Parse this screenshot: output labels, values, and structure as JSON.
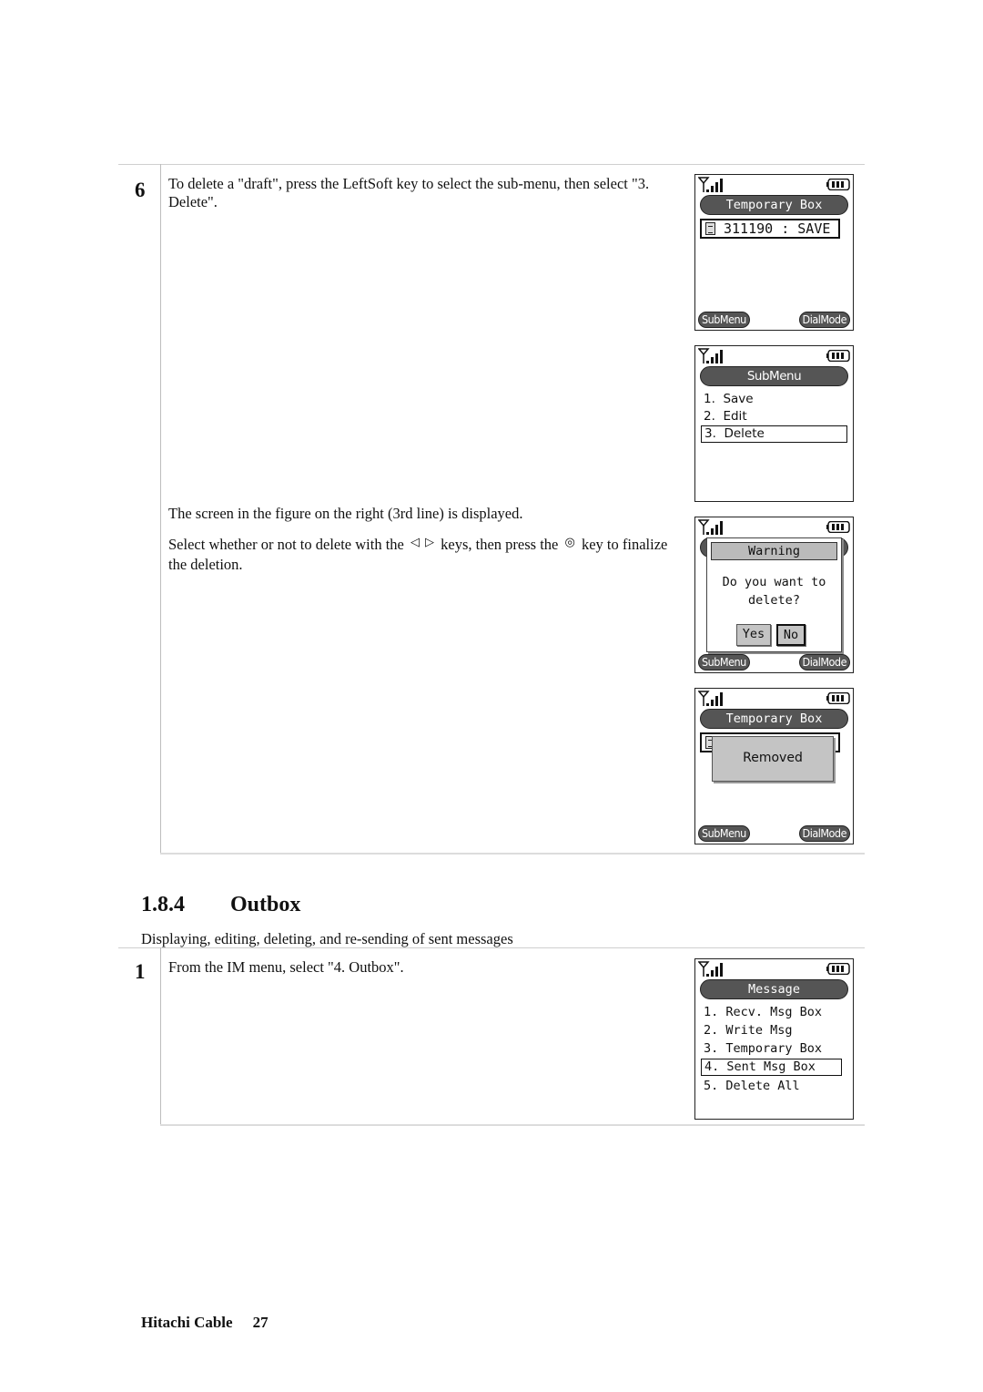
{
  "step6": {
    "number": "6",
    "text": "To delete a \"draft\", press the LeftSoft key to select the sub-menu, then select \"3. Delete\".",
    "displayed_text": "The screen in the figure on the right (3rd line) is displayed.",
    "select_prefix": "Select whether or not to delete with the",
    "left_key_glyph": "◁",
    "right_key_glyph": "▷",
    "select_middle": "keys, then press the",
    "center_key_glyph": "◎",
    "select_suffix": "key to finalize the deletion."
  },
  "screens": {
    "temporary_box": {
      "title": "Temporary Box",
      "entry": "311190 : SAVE",
      "left_softkey": "SubMenu",
      "right_softkey": "DialMode"
    },
    "submenu": {
      "title": "SubMenu",
      "items": [
        {
          "label": "1.  Save",
          "selected": false
        },
        {
          "label": "2.  Edit",
          "selected": false
        },
        {
          "label": "3.  Delete",
          "selected": true
        }
      ]
    },
    "warning": {
      "title": "Warning",
      "message_line1": "Do you want to",
      "message_line2": "delete?",
      "yes_label": "Yes",
      "no_label": "No",
      "left_softkey": "SubMenu",
      "right_softkey": "DialMode"
    },
    "removed": {
      "title": "Temporary Box",
      "popup": "Removed",
      "left_softkey": "SubMenu",
      "right_softkey": "DialMode"
    },
    "message_menu": {
      "title": "Message",
      "items": [
        {
          "label": "1. Recv. Msg Box",
          "selected": false
        },
        {
          "label": "2. Write Msg",
          "selected": false
        },
        {
          "label": "3. Temporary Box",
          "selected": false
        },
        {
          "label": "4. Sent Msg Box",
          "selected": true
        },
        {
          "label": "5. Delete All",
          "selected": false
        }
      ]
    }
  },
  "section": {
    "number": "1.8.4",
    "title": "Outbox",
    "subtitle": "Displaying, editing, deleting, and re-sending of sent messages"
  },
  "step1": {
    "number": "1",
    "text": "From the IM menu, select \"4. Outbox\"."
  },
  "footer": {
    "brand": "Hitachi Cable",
    "page": "27"
  }
}
